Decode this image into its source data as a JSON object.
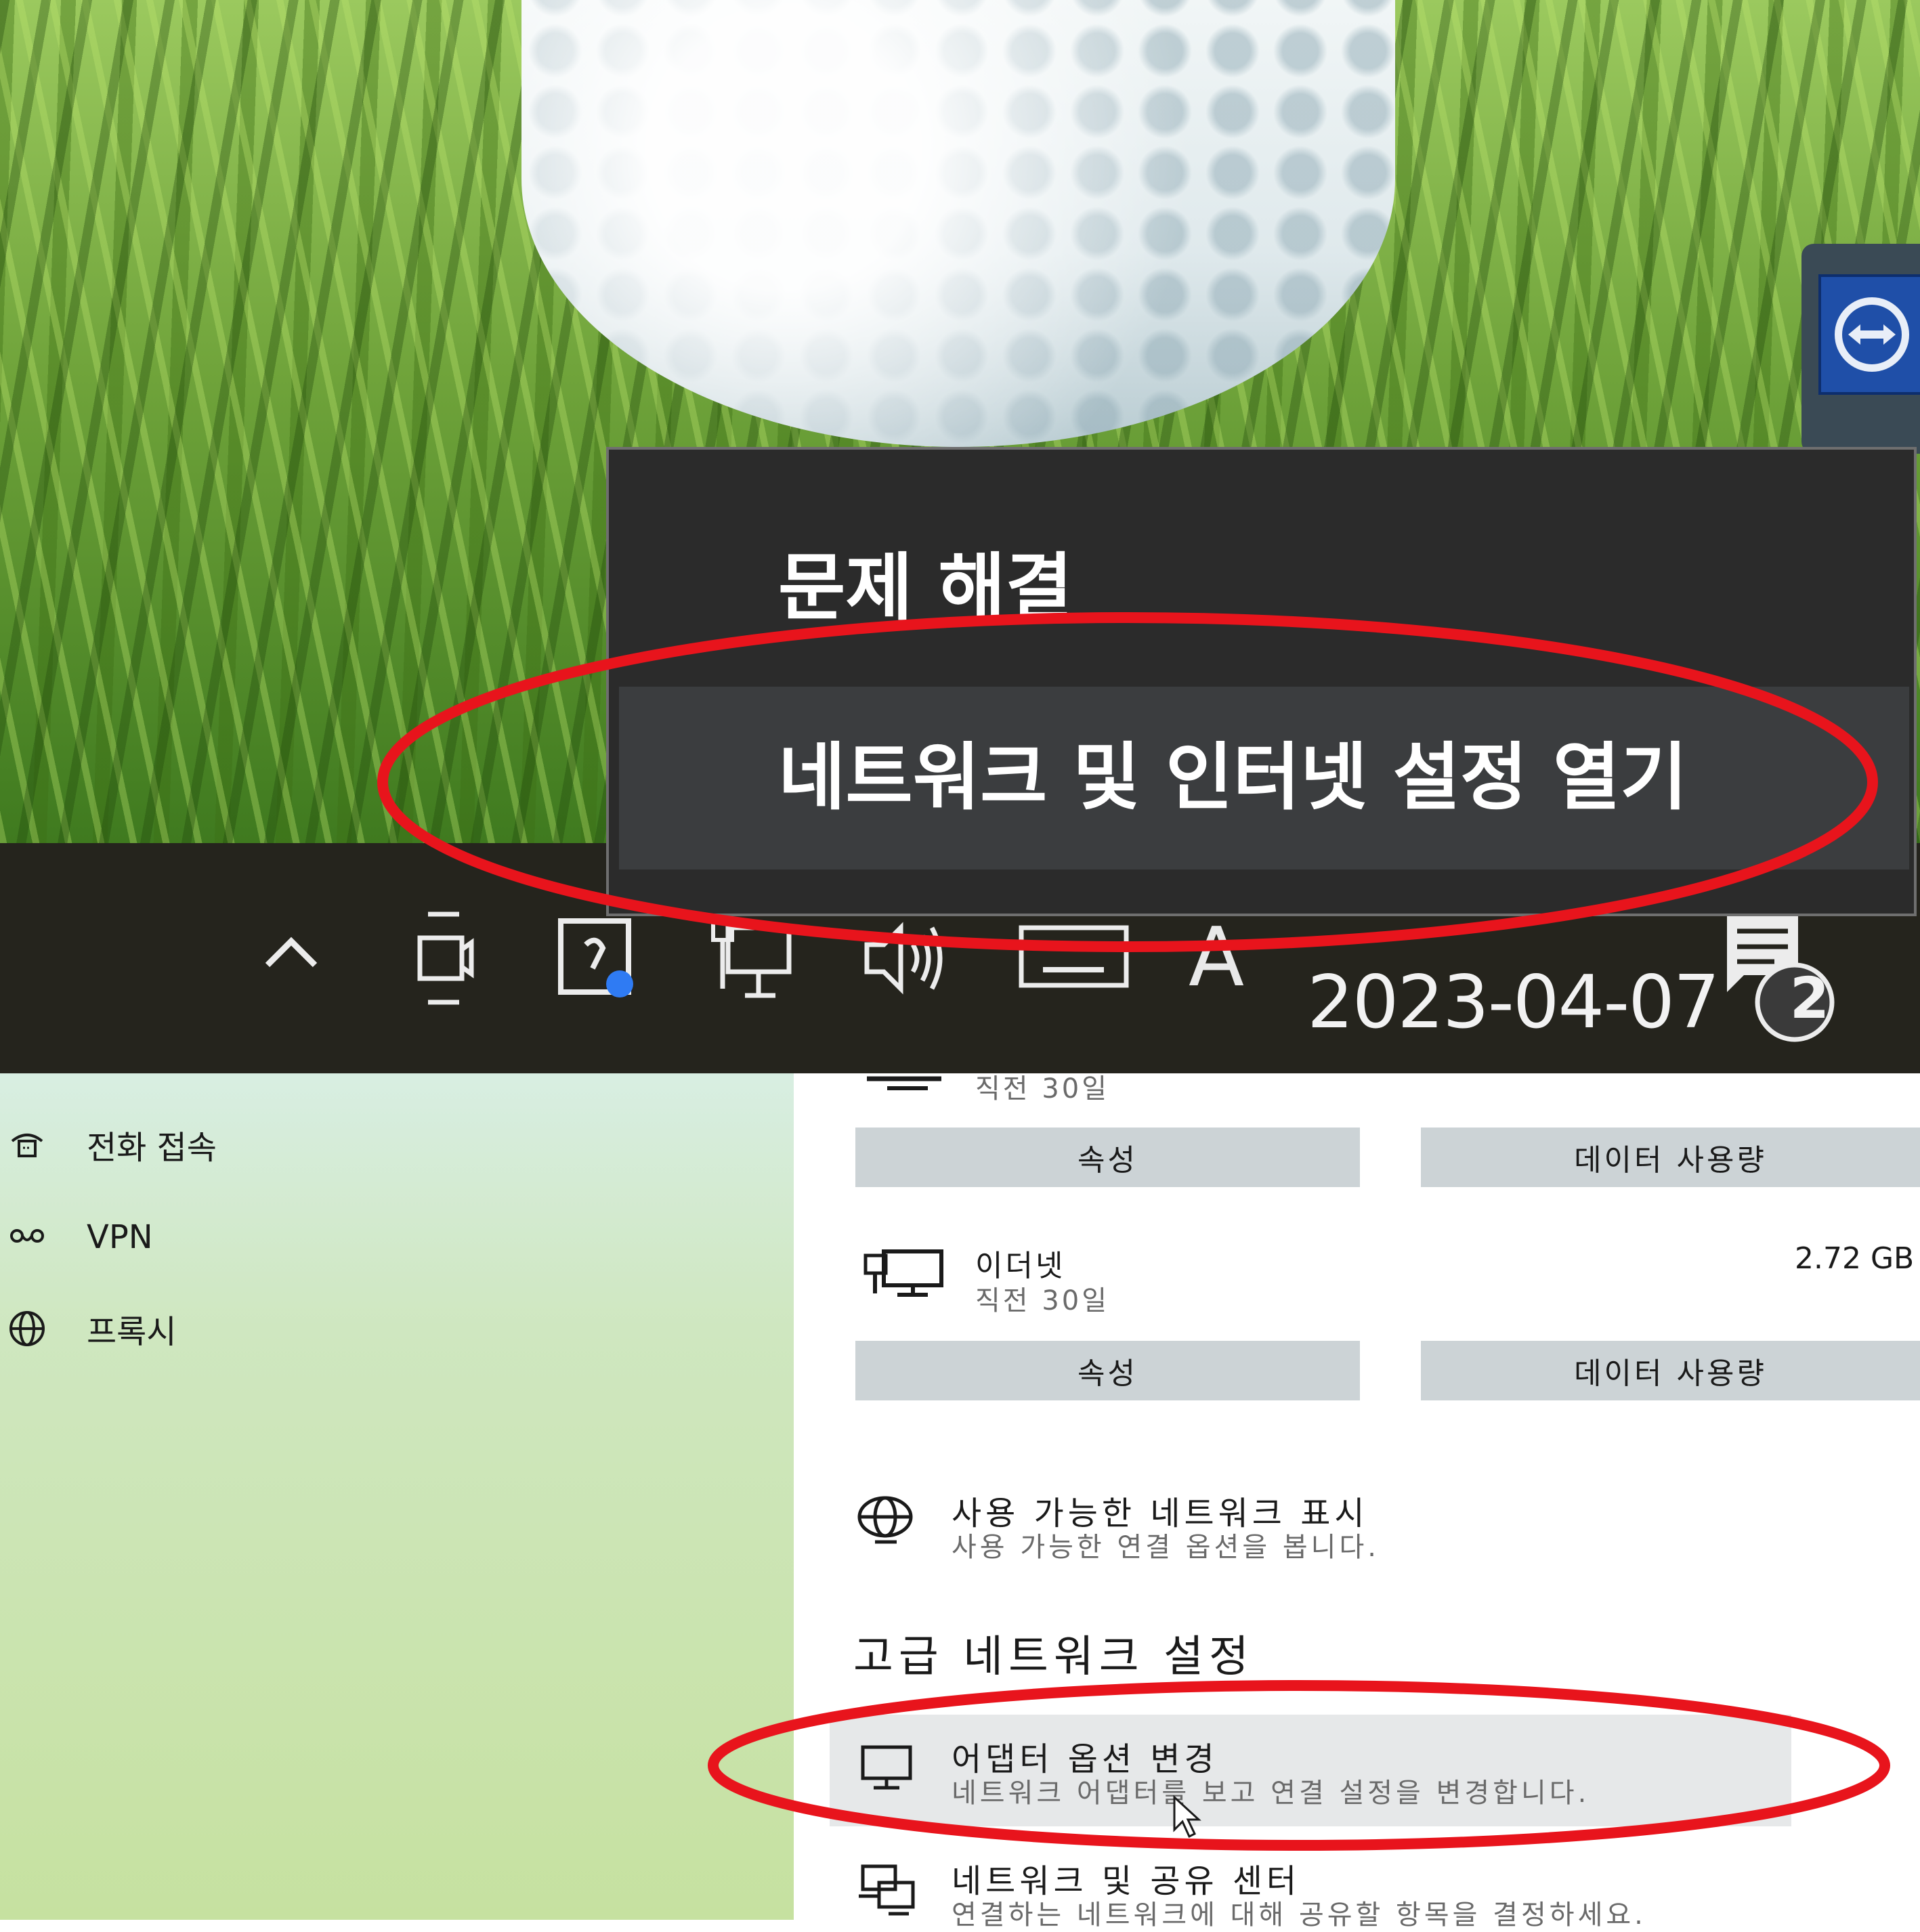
{
  "context_menu": {
    "items": [
      {
        "label": "문제 해결"
      },
      {
        "label": "네트워크 및 인터넷 설정 열기"
      }
    ]
  },
  "taskbar": {
    "date": "2023-04-07",
    "ime_label": "A",
    "notification_count": "2",
    "icons": [
      "chevron-up-icon",
      "camera-icon",
      "app-icon",
      "network-icon",
      "volume-icon",
      "keyboard-icon",
      "ime-icon",
      "notification-icon"
    ]
  },
  "sidebar": {
    "items": [
      {
        "label": "전화 접속",
        "icon": "dialup-icon"
      },
      {
        "label": "VPN",
        "icon": "vpn-icon"
      },
      {
        "label": "프록시",
        "icon": "globe-icon"
      }
    ]
  },
  "main": {
    "network_top": {
      "sub": "직전 30일"
    },
    "buttons_row1": {
      "properties": "속성",
      "data_usage": "데이터 사용량"
    },
    "ethernet": {
      "name": "이더넷",
      "sub": "직전 30일",
      "size": "2.72 GB"
    },
    "buttons_row2": {
      "properties": "속성",
      "data_usage": "데이터 사용량"
    },
    "show_networks": {
      "title": "사용 가능한 네트워크 표시",
      "desc": "사용 가능한 연결 옵션을 봅니다."
    },
    "advanced_heading": "고급 네트워크 설정",
    "adapter_options": {
      "title": "어댑터 옵션 변경",
      "desc": "네트워크 어댑터를 보고 연결 설정을 변경합니다."
    },
    "sharing_center": {
      "title": "네트워크 및 공유 센터",
      "desc": "연결하는 네트워크에 대해 공유할 항목을 결정하세요."
    }
  },
  "colors": {
    "annotation": "#e8141c",
    "menu_bg": "#2b2b2b",
    "taskbar_bg": "#25241d",
    "accent_dot": "#2f7bf3"
  }
}
